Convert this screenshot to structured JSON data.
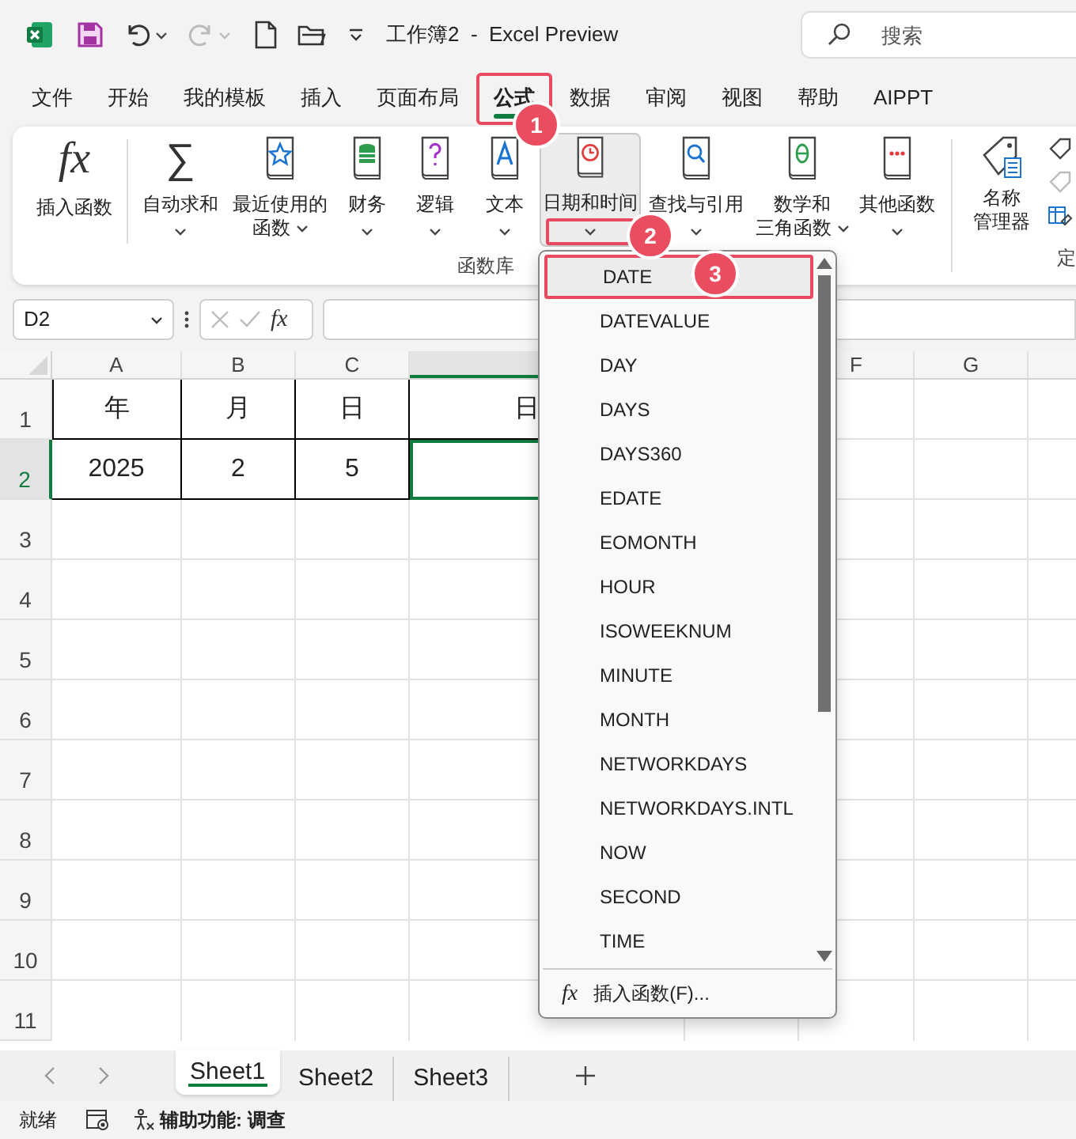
{
  "title_bar": {
    "title": "工作簿2  -  Excel Preview",
    "search": {
      "placeholder": "搜索"
    }
  },
  "menu_tabs": [
    {
      "label": "文件",
      "selected": false,
      "highlighted": false
    },
    {
      "label": "开始",
      "selected": false,
      "highlighted": false
    },
    {
      "label": "我的模板",
      "selected": false,
      "highlighted": false
    },
    {
      "label": "插入",
      "selected": false,
      "highlighted": false
    },
    {
      "label": "页面布局",
      "selected": false,
      "highlighted": false
    },
    {
      "label": "公式",
      "selected": true,
      "highlighted": true
    },
    {
      "label": "数据",
      "selected": false,
      "highlighted": false
    },
    {
      "label": "审阅",
      "selected": false,
      "highlighted": false
    },
    {
      "label": "视图",
      "selected": false,
      "highlighted": false
    },
    {
      "label": "帮助",
      "selected": false,
      "highlighted": false
    },
    {
      "label": "AIPPT",
      "selected": false,
      "highlighted": false
    }
  ],
  "ribbon": {
    "insert_function": {
      "icon_text": "fx",
      "label": "插入函数"
    },
    "buttons": [
      {
        "lines": [
          "自动求和"
        ],
        "icon_text": "∑",
        "selected": false,
        "highlighted": false
      },
      {
        "lines": [
          "最近使用的",
          "函数"
        ],
        "selected": false,
        "highlighted": false
      },
      {
        "lines": [
          "财务"
        ],
        "selected": false,
        "highlighted": false
      },
      {
        "lines": [
          "逻辑"
        ],
        "selected": false,
        "highlighted": false
      },
      {
        "lines": [
          "文本"
        ],
        "selected": false,
        "highlighted": false
      },
      {
        "lines": [
          "日期和时间"
        ],
        "selected": true,
        "highlighted": true
      },
      {
        "lines": [
          "查找与引用"
        ],
        "selected": false,
        "highlighted": false
      },
      {
        "lines": [
          "数学和",
          "三角函数"
        ],
        "selected": false,
        "highlighted": false
      },
      {
        "lines": [
          "其他函数"
        ],
        "selected": false,
        "highlighted": false
      }
    ],
    "group_label": "函数库",
    "name_manager": {
      "lines": [
        "名称",
        "管理器"
      ]
    },
    "next_group_label": "定"
  },
  "formula_bar": {
    "name_box": "D2",
    "fx": "fx"
  },
  "columns": [
    {
      "label": "A",
      "selected": false
    },
    {
      "label": "B",
      "selected": false
    },
    {
      "label": "C",
      "selected": false
    },
    {
      "selected": true
    },
    {
      "label": "F",
      "selected": false
    },
    {
      "label": "G",
      "selected": false
    }
  ],
  "rows": [
    {
      "label": "1",
      "selected": false,
      "cells": [
        "年",
        "月",
        "日",
        "日"
      ]
    },
    {
      "label": "2",
      "selected": true,
      "cells": [
        "2025",
        "2",
        "5"
      ]
    },
    {
      "label": "3",
      "selected": false
    },
    {
      "label": "4",
      "selected": false
    },
    {
      "label": "5",
      "selected": false
    },
    {
      "label": "6",
      "selected": false
    },
    {
      "label": "7",
      "selected": false
    },
    {
      "label": "8",
      "selected": false
    },
    {
      "label": "9",
      "selected": false
    },
    {
      "label": "10",
      "selected": false
    },
    {
      "label": "11",
      "selected": false
    }
  ],
  "dropdown": {
    "items": [
      {
        "label": "DATE",
        "selected": true,
        "highlighted": true
      },
      {
        "label": "DATEVALUE",
        "selected": false,
        "highlighted": false
      },
      {
        "label": "DAY",
        "selected": false,
        "highlighted": false
      },
      {
        "label": "DAYS",
        "selected": false,
        "highlighted": false
      },
      {
        "label": "DAYS360",
        "selected": false,
        "highlighted": false
      },
      {
        "label": "EDATE",
        "selected": false,
        "highlighted": false
      },
      {
        "label": "EOMONTH",
        "selected": false,
        "highlighted": false
      },
      {
        "label": "HOUR",
        "selected": false,
        "highlighted": false
      },
      {
        "label": "ISOWEEKNUM",
        "selected": false,
        "highlighted": false
      },
      {
        "label": "MINUTE",
        "selected": false,
        "highlighted": false
      },
      {
        "label": "MONTH",
        "selected": false,
        "highlighted": false
      },
      {
        "label": "NETWORKDAYS",
        "selected": false,
        "highlighted": false
      },
      {
        "label": "NETWORKDAYS.INTL",
        "selected": false,
        "highlighted": false
      },
      {
        "label": "NOW",
        "selected": false,
        "highlighted": false
      },
      {
        "label": "SECOND",
        "selected": false,
        "highlighted": false
      },
      {
        "label": "TIME",
        "selected": false,
        "highlighted": false
      }
    ],
    "footer": {
      "icon_text": "fx",
      "label": "插入函数(F)..."
    }
  },
  "callouts": [
    "1",
    "2",
    "3"
  ],
  "sheet_tabs": [
    {
      "label": "Sheet1",
      "selected": true
    },
    {
      "label": "Sheet2",
      "selected": false
    },
    {
      "label": "Sheet3",
      "selected": false
    }
  ],
  "status_bar": {
    "ready": "就绪",
    "accessibility": "辅助功能: 调查"
  }
}
